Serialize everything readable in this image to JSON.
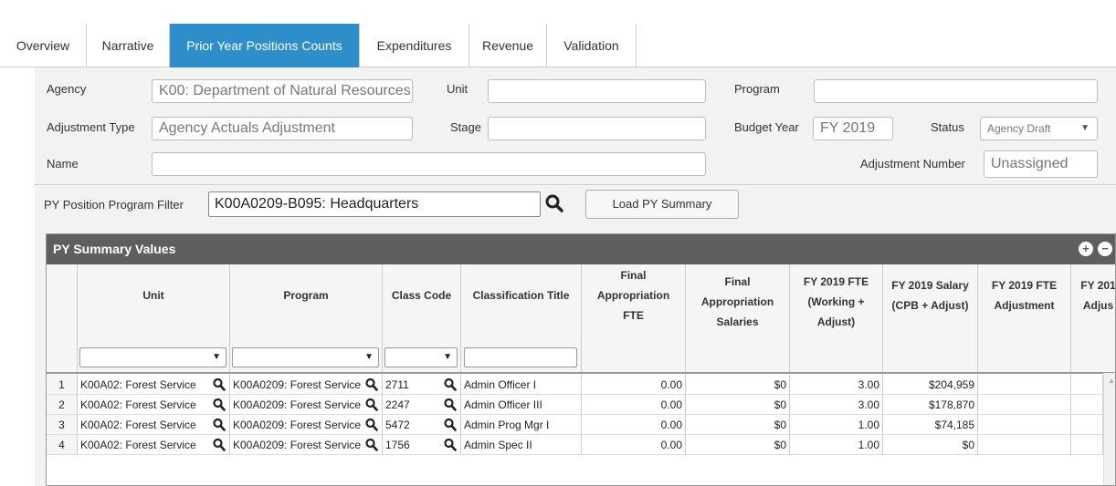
{
  "tabs": [
    {
      "label": "Overview",
      "active": false
    },
    {
      "label": "Narrative",
      "active": false
    },
    {
      "label": "Prior Year Positions Counts",
      "active": true
    },
    {
      "label": "Expenditures",
      "active": false
    },
    {
      "label": "Revenue",
      "active": false
    },
    {
      "label": "Validation",
      "active": false
    }
  ],
  "form": {
    "agency_label": "Agency",
    "agency_value": "K00: Department of Natural Resources",
    "unit_label": "Unit",
    "unit_value": "",
    "program_label": "Program",
    "program_value": "",
    "adjustment_type_label": "Adjustment Type",
    "adjustment_type_value": "Agency Actuals Adjustment",
    "stage_label": "Stage",
    "stage_value": "",
    "budget_year_label": "Budget Year",
    "budget_year_value": "FY 2019",
    "status_label": "Status",
    "status_value": "Agency Draft",
    "name_label": "Name",
    "name_value": "",
    "adjustment_number_label": "Adjustment Number",
    "adjustment_number_value": "Unassigned"
  },
  "filter": {
    "label": "PY Position Program Filter",
    "value": "K00A0209-B095: Headquarters",
    "load_button": "Load PY Summary"
  },
  "grid": {
    "title": "PY Summary Values",
    "columns": [
      "Unit",
      "Program",
      "Class Code",
      "Classification Title",
      "Final Appropriation FTE",
      "Final Appropriation Salaries",
      "FY 2019 FTE (Working + Adjust)",
      "FY 2019 Salary (CPB + Adjust)",
      "FY 2019 FTE Adjustment",
      "FY 201 Adjus"
    ],
    "rows": [
      {
        "idx": "1",
        "unit": "K00A02: Forest Service",
        "program": "K00A0209: Forest Service",
        "class_code": "2711",
        "title": "Admin Officer I",
        "fa_fte": "0.00",
        "fa_sal": "$0",
        "fy_fte": "3.00",
        "fy_sal": "$204,959",
        "fte_adj": "",
        "sal_adj": ""
      },
      {
        "idx": "2",
        "unit": "K00A02: Forest Service",
        "program": "K00A0209: Forest Service",
        "class_code": "2247",
        "title": "Admin Officer III",
        "fa_fte": "0.00",
        "fa_sal": "$0",
        "fy_fte": "3.00",
        "fy_sal": "$178,870",
        "fte_adj": "",
        "sal_adj": ""
      },
      {
        "idx": "3",
        "unit": "K00A02: Forest Service",
        "program": "K00A0209: Forest Service",
        "class_code": "5472",
        "title": "Admin Prog Mgr I",
        "fa_fte": "0.00",
        "fa_sal": "$0",
        "fy_fte": "1.00",
        "fy_sal": "$74,185",
        "fte_adj": "",
        "sal_adj": ""
      },
      {
        "idx": "4",
        "unit": "K00A02: Forest Service",
        "program": "K00A0209: Forest Service",
        "class_code": "1756",
        "title": "Admin Spec II",
        "fa_fte": "0.00",
        "fa_sal": "$0",
        "fy_fte": "1.00",
        "fy_sal": "$0",
        "fte_adj": "",
        "sal_adj": ""
      }
    ]
  },
  "icons": {
    "search": "magnifier-icon",
    "expand": "plus-circle-icon",
    "collapse": "minus-circle-icon"
  },
  "colors": {
    "active_tab": "#2d8ec9",
    "grid_header": "#5f5f5f",
    "panel_bg": "#f2f2f2"
  }
}
